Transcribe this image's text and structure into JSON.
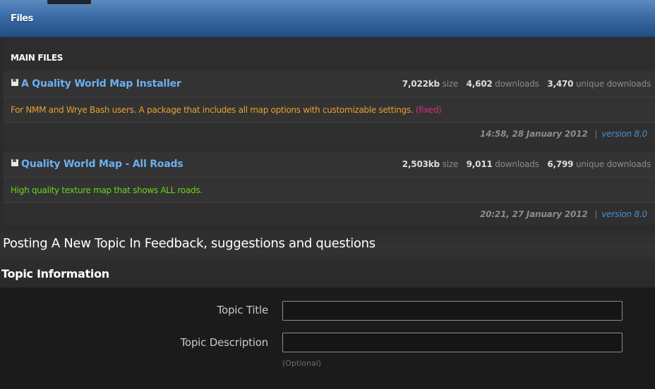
{
  "files_header": {
    "title": "Files"
  },
  "main_files": {
    "section_title": "MAIN FILES",
    "files": [
      {
        "name": "A Quality World Map Installer",
        "size_value": "7,022kb",
        "size_label": "size",
        "downloads_value": "4,602",
        "downloads_label": "downloads",
        "unique_value": "3,470",
        "unique_label": "unique downloads",
        "description": "For NMM and Wrye Bash users. A package that includes all map options with customizable settings.",
        "description_tag": "(fixed)",
        "description_color": "#e8a030",
        "tag_color": "#d0307a",
        "date": "14:58, 28 January 2012",
        "separator": "|",
        "version": "version 8.0"
      },
      {
        "name": "Quality World Map - All Roads",
        "size_value": "2,503kb",
        "size_label": "size",
        "downloads_value": "9,011",
        "downloads_label": "downloads",
        "unique_value": "6,799",
        "unique_label": "unique downloads",
        "description": "High quality texture map that shows ALL roads.",
        "description_tag": "",
        "description_color": "#6fd020",
        "tag_color": "#d0307a",
        "date": "20:21, 27 January 2012",
        "separator": "|",
        "version": "version 8.0"
      }
    ]
  },
  "posting": {
    "title": "Posting A New Topic In Feedback, suggestions and questions"
  },
  "topic_info": {
    "title": "Topic Information",
    "topic_title_label": "Topic Title",
    "topic_title_value": "",
    "topic_description_label": "Topic Description",
    "topic_description_value": "",
    "optional_hint": "(Optional)"
  },
  "icons": {
    "file": "floppy-disk-icon"
  },
  "colors": {
    "header_blue": "#3a6ba6",
    "link_blue": "#6ab0f0",
    "version_blue": "#4a8fd1"
  }
}
